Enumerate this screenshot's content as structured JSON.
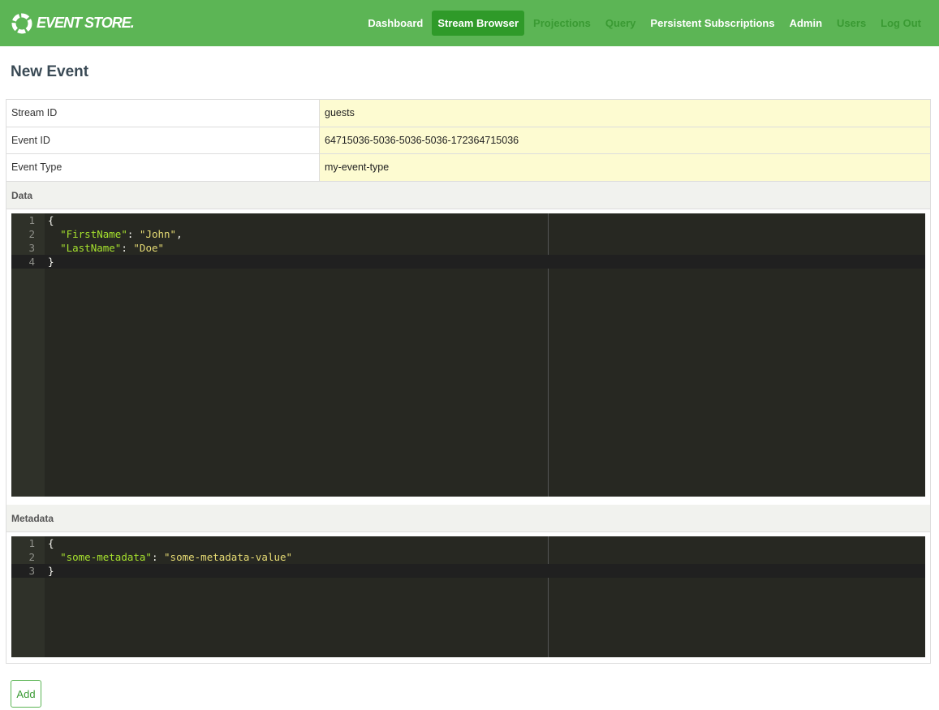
{
  "header": {
    "logo_text": "EVENT STORE.",
    "nav": [
      {
        "label": "Dashboard",
        "state": "normal"
      },
      {
        "label": "Stream Browser",
        "state": "active"
      },
      {
        "label": "Projections",
        "state": "dim"
      },
      {
        "label": "Query",
        "state": "dim"
      },
      {
        "label": "Persistent Subscriptions",
        "state": "normal"
      },
      {
        "label": "Admin",
        "state": "normal"
      },
      {
        "label": "Users",
        "state": "dim"
      },
      {
        "label": "Log Out",
        "state": "dim"
      }
    ]
  },
  "page_title": "New Event",
  "form": {
    "stream_id": {
      "label": "Stream ID",
      "value": "guests"
    },
    "event_id": {
      "label": "Event ID",
      "value": "64715036-5036-5036-5036-172364715036"
    },
    "event_type": {
      "label": "Event Type",
      "value": "my-event-type"
    },
    "data_label": "Data",
    "metadata_label": "Metadata",
    "data_lines": [
      "{",
      "  \"FirstName\": \"John\",",
      "  \"LastName\": \"Doe\"",
      "}"
    ],
    "metadata_lines": [
      "{",
      "  \"some-metadata\": \"some-metadata-value\"",
      "}"
    ]
  },
  "add_label": "Add",
  "colors": {
    "header": "#5cb555",
    "active_nav": "#2f9a29",
    "editor_bg": "#272822",
    "field_bg": "#fdfbd1"
  }
}
